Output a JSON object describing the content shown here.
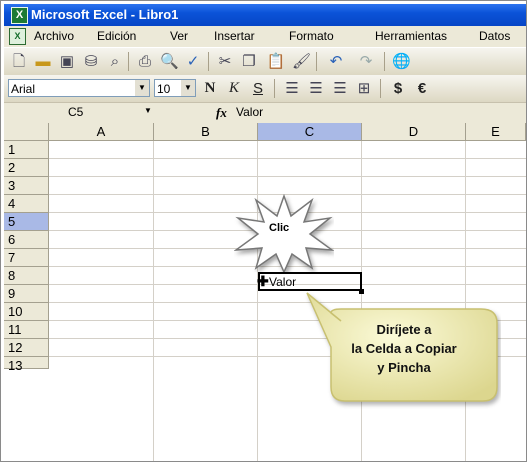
{
  "window": {
    "title": "Microsoft Excel - Libro1",
    "app_icon": "excel-logo-icon",
    "accent": "#0b53d8"
  },
  "menu": {
    "items": [
      "Archivo",
      "Edición",
      "Ver",
      "Insertar",
      "Formato",
      "Herramientas",
      "Datos"
    ]
  },
  "toolbar_standard": {
    "icons": [
      "new-document-icon",
      "open-folder-icon",
      "save-icon",
      "permission-icon",
      "search-icon",
      "print-icon",
      "print-preview-icon",
      "spelling-icon",
      "cut-icon",
      "copy-icon",
      "paste-icon",
      "format-painter-icon",
      "undo-icon",
      "redo-icon",
      "hyperlink-icon"
    ]
  },
  "toolbar_format": {
    "font_name": "Arial",
    "font_size": "10",
    "bold_label": "N",
    "italic_label": "K",
    "underline_label": "S",
    "currency_label": "$",
    "euro_label": "€"
  },
  "formula_bar": {
    "name_box": "C5",
    "fx_label": "fx",
    "value": "Valor"
  },
  "sheet": {
    "columns": [
      "A",
      "B",
      "C",
      "D",
      "E"
    ],
    "rows": [
      "1",
      "2",
      "3",
      "4",
      "5",
      "6",
      "7",
      "8",
      "9",
      "10",
      "11",
      "12",
      "13"
    ],
    "selected_column": "C",
    "selected_row": "5",
    "active_cell_value": "Valor"
  },
  "annotations": {
    "click_burst": "Clic",
    "callout_lines": [
      "Diríjete a",
      "la Celda a Copiar",
      "y Pincha"
    ],
    "callout_color": "#f3f0b5"
  }
}
